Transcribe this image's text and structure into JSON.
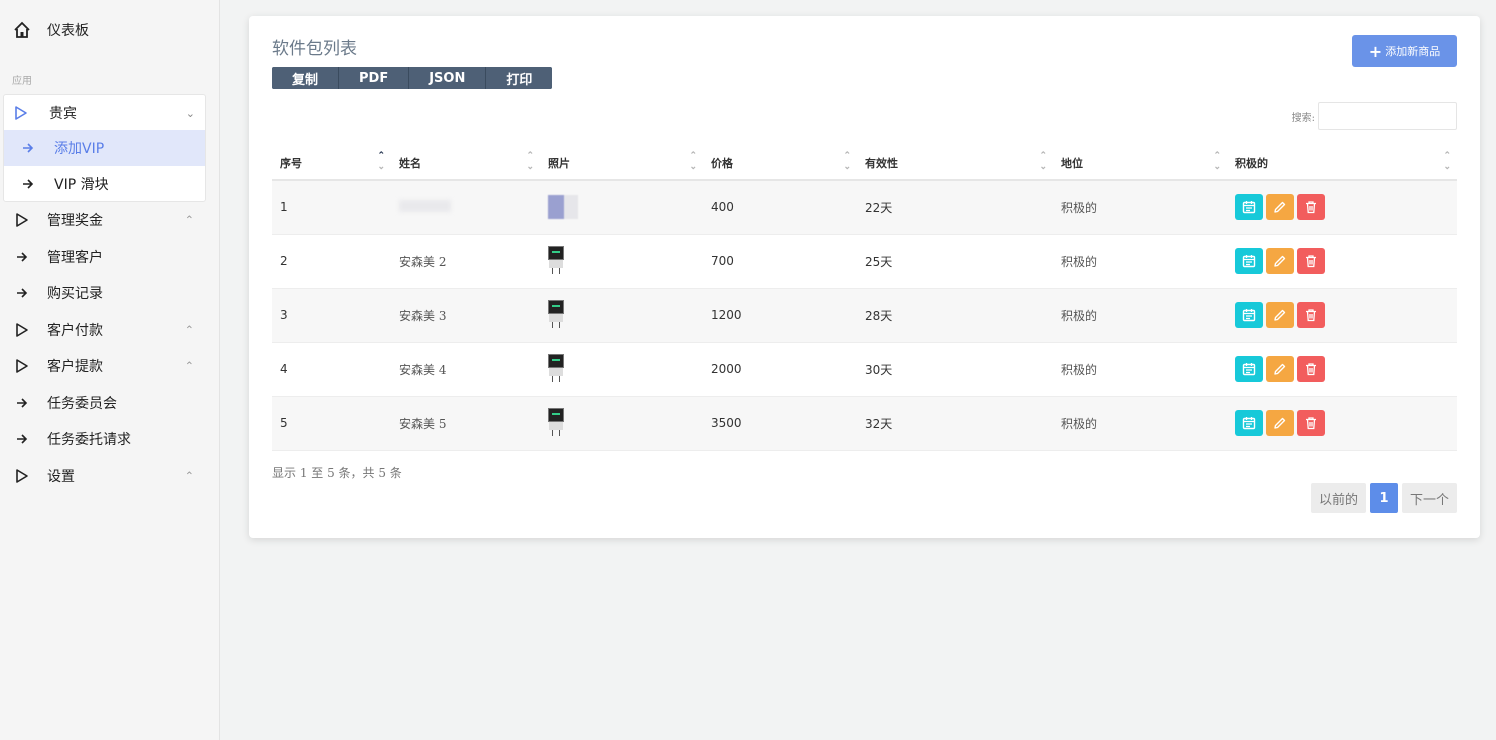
{
  "sidebar": {
    "dashboard": "仪表板",
    "section_label": "应用",
    "vip": "贵宾",
    "vip_sub": [
      "添加VIP",
      "VIP 滑块"
    ],
    "items": [
      {
        "label": "管理奖金",
        "type": "triangle",
        "chev": "up"
      },
      {
        "label": "管理客户",
        "type": "arrow"
      },
      {
        "label": "购买记录",
        "type": "arrow"
      },
      {
        "label": "客户付款",
        "type": "triangle",
        "chev": "up"
      },
      {
        "label": "客户提款",
        "type": "triangle",
        "chev": "up"
      },
      {
        "label": "任务委员会",
        "type": "arrow"
      },
      {
        "label": "任务委托请求",
        "type": "arrow"
      },
      {
        "label": "设置",
        "type": "triangle",
        "chev": "up"
      }
    ]
  },
  "card": {
    "title": "软件包列表",
    "add_button": "添加新商品",
    "export_buttons": [
      "复制",
      "PDF",
      "JSON",
      "打印"
    ],
    "search_label": "搜索:"
  },
  "table": {
    "headers": [
      "序号",
      "姓名",
      "照片",
      "价格",
      "有效性",
      "地位",
      "积极的"
    ],
    "rows": [
      {
        "id": "1",
        "name": "",
        "price": "400",
        "validity": "22天",
        "status": "积极的"
      },
      {
        "id": "2",
        "name": "安森美 2",
        "price": "700",
        "validity": "25天",
        "status": "积极的"
      },
      {
        "id": "3",
        "name": "安森美 3",
        "price": "1200",
        "validity": "28天",
        "status": "积极的"
      },
      {
        "id": "4",
        "name": "安森美 4",
        "price": "2000",
        "validity": "30天",
        "status": "积极的"
      },
      {
        "id": "5",
        "name": "安森美 5",
        "price": "3500",
        "validity": "32天",
        "status": "积极的"
      }
    ]
  },
  "summary": "显示 1 至 5 条，共 5 条",
  "pagination": {
    "prev": "以前的",
    "current": "1",
    "next": "下一个"
  },
  "colors": {
    "accent": "#6a93e8",
    "cyan": "#17c9d9",
    "orange": "#f5a742",
    "red": "#f25d5d",
    "export": "#4e6076"
  },
  "icons": {
    "dashboard": "home-icon",
    "group": "triangle-right-icon",
    "link": "arrow-right-icon",
    "calendar": "calendar-icon",
    "edit": "pencil-icon",
    "delete": "trash-icon"
  }
}
